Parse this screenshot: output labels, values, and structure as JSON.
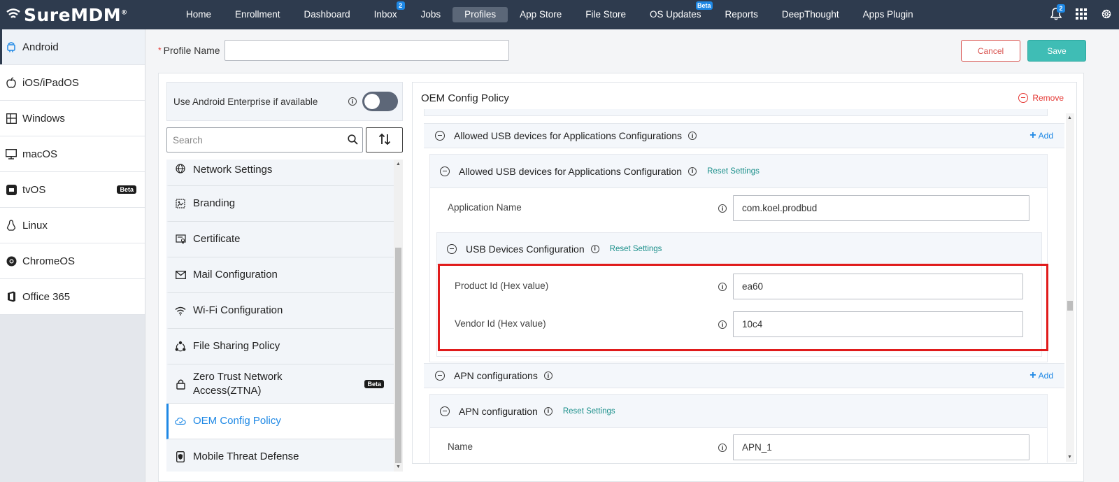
{
  "app": {
    "brand": "SureMDM",
    "brand_mark": "®"
  },
  "nav": {
    "items": [
      {
        "label": "Home"
      },
      {
        "label": "Enrollment"
      },
      {
        "label": "Dashboard"
      },
      {
        "label": "Inbox",
        "badge": "2"
      },
      {
        "label": "Jobs"
      },
      {
        "label": "Profiles",
        "active": true
      },
      {
        "label": "App Store"
      },
      {
        "label": "File Store"
      },
      {
        "label": "OS Updates",
        "badge": "Beta"
      },
      {
        "label": "Reports"
      },
      {
        "label": "DeepThought"
      },
      {
        "label": "Apps Plugin"
      }
    ],
    "notifications_badge": "2"
  },
  "platforms": [
    {
      "label": "Android",
      "icon": "android-icon",
      "active": true
    },
    {
      "label": "iOS/iPadOS",
      "icon": "apple-icon"
    },
    {
      "label": "Windows",
      "icon": "windows-icon"
    },
    {
      "label": "macOS",
      "icon": "monitor-icon"
    },
    {
      "label": "tvOS",
      "icon": "tv-icon",
      "badge": "Beta"
    },
    {
      "label": "Linux",
      "icon": "linux-icon"
    },
    {
      "label": "ChromeOS",
      "icon": "chrome-icon"
    },
    {
      "label": "Office 365",
      "icon": "office-icon"
    }
  ],
  "profile": {
    "name_label": "Profile Name",
    "required_mark": "*",
    "name_value": "",
    "cancel_label": "Cancel",
    "save_label": "Save"
  },
  "android_enterprise": {
    "label": "Use Android Enterprise if available",
    "enabled": true
  },
  "search": {
    "placeholder": "Search"
  },
  "policies": [
    {
      "label": "Network Settings",
      "icon": "globe-icon"
    },
    {
      "label": "Branding",
      "icon": "branding-icon"
    },
    {
      "label": "Certificate",
      "icon": "certificate-icon"
    },
    {
      "label": "Mail Configuration",
      "icon": "mail-icon"
    },
    {
      "label": "Wi-Fi Configuration",
      "icon": "wifi-icon"
    },
    {
      "label": "File Sharing Policy",
      "icon": "share-icon"
    },
    {
      "label": "Zero Trust Network Access(ZTNA)",
      "icon": "lock-icon",
      "badge": "Beta"
    },
    {
      "label": "OEM Config Policy",
      "icon": "cloud-icon",
      "active": true
    },
    {
      "label": "Mobile Threat Defense",
      "icon": "phone-shield-icon"
    }
  ],
  "detail": {
    "title": "OEM Config Policy",
    "remove_label": "Remove",
    "usb_apps_section": {
      "title": "Allowed USB devices for Applications Configurations",
      "add_label": "Add",
      "item": {
        "title": "Allowed USB devices for Applications Configuration",
        "reset_label": "Reset Settings",
        "app_name_label": "Application Name",
        "app_name_value": "com.koel.prodbud",
        "usb_devices": {
          "title": "USB Devices Configuration",
          "reset_label": "Reset Settings",
          "product_id_label": "Product Id (Hex value)",
          "product_id_value": "ea60",
          "vendor_id_label": "Vendor Id (Hex value)",
          "vendor_id_value": "10c4"
        }
      }
    },
    "apn_section": {
      "title": "APN configurations",
      "add_label": "Add",
      "item": {
        "title": "APN configuration",
        "reset_label": "Reset Settings",
        "name_label": "Name",
        "name_value": "APN_1"
      }
    }
  },
  "colors": {
    "nav_bg": "#2e3b4e",
    "accent_blue": "#1e88e5",
    "save_teal": "#3fbdb5",
    "cancel_red": "#d9534f",
    "highlight_red": "#e01b1b"
  }
}
